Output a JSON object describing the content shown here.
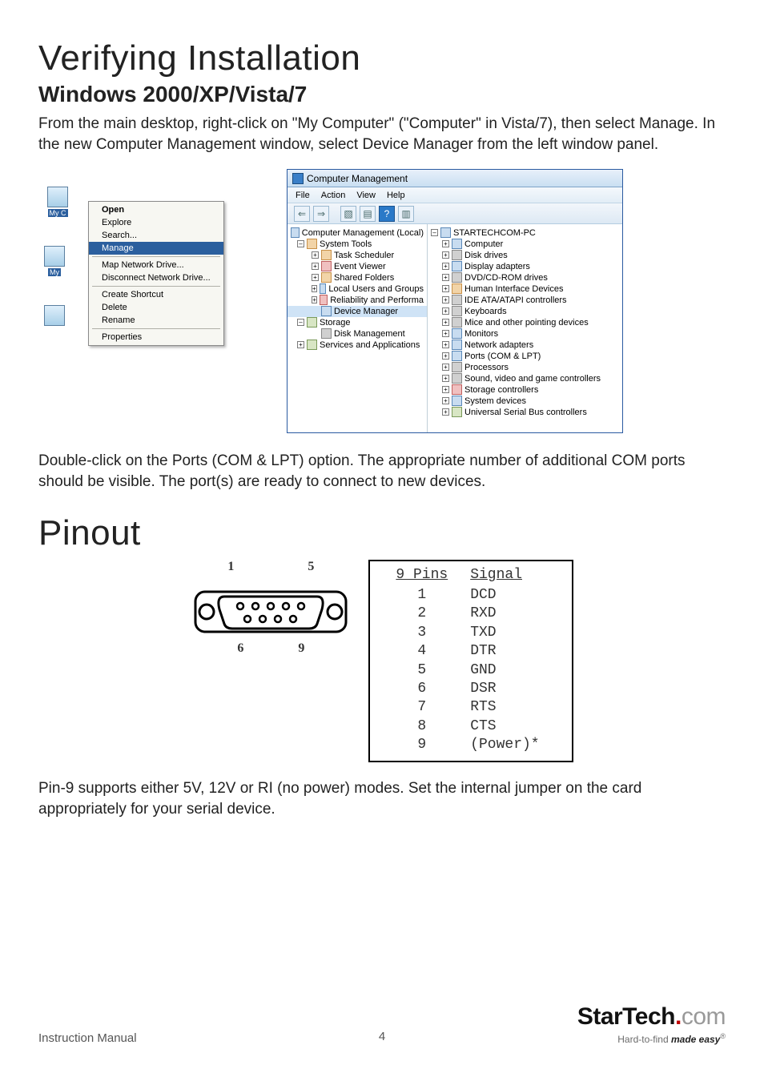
{
  "headings": {
    "h1_verify": "Verifying Installation",
    "h2_os": "Windows 2000/XP/Vista/7",
    "h1_pinout": "Pinout"
  },
  "paragraphs": {
    "intro": "From the main desktop, right-click on \"My Computer\" (\"Computer\" in Vista/7), then select Manage. In the new Computer Management window, select Device Manager from the left window panel.",
    "ports_note": "Double-click on the Ports (COM & LPT) option. The appropriate number of additional COM ports should be visible. The port(s) are ready to connect to new devices.",
    "pin9_note": "Pin-9 supports either 5V, 12V or RI (no power) modes.  Set the internal jumper on the card appropriately for your serial device."
  },
  "desktop_icons": {
    "icon1_label": "My C",
    "icon2_label": "My"
  },
  "context_menu": {
    "items_group1": [
      "Open",
      "Explore",
      "Search...",
      "Manage"
    ],
    "items_group2": [
      "Map Network Drive...",
      "Disconnect Network Drive..."
    ],
    "items_group3": [
      "Create Shortcut",
      "Delete",
      "Rename"
    ],
    "items_group4": [
      "Properties"
    ],
    "bold_index": 0,
    "selected_item": "Manage"
  },
  "cm_window": {
    "title": "Computer Management",
    "menus": [
      "File",
      "Action",
      "View",
      "Help"
    ],
    "toolbar_icons": [
      "back-icon",
      "forward-icon",
      "up-icon",
      "properties-icon",
      "help-icon",
      "refresh-icon"
    ],
    "left_tree": {
      "root": "Computer Management (Local)",
      "groups": [
        {
          "label": "System Tools",
          "children": [
            "Task Scheduler",
            "Event Viewer",
            "Shared Folders",
            "Local Users and Groups",
            "Reliability and Performa",
            "Device Manager"
          ],
          "selected": "Device Manager"
        },
        {
          "label": "Storage",
          "children": [
            "Disk Management"
          ]
        },
        {
          "label": "Services and Applications",
          "children": []
        }
      ]
    },
    "right_tree": {
      "root": "STARTECHCOM-PC",
      "children": [
        "Computer",
        "Disk drives",
        "Display adapters",
        "DVD/CD-ROM drives",
        "Human Interface Devices",
        "IDE ATA/ATAPI controllers",
        "Keyboards",
        "Mice and other pointing devices",
        "Monitors",
        "Network adapters",
        "Ports (COM & LPT)",
        "Processors",
        "Sound, video and game controllers",
        "Storage controllers",
        "System devices",
        "Universal Serial Bus controllers"
      ]
    }
  },
  "connector_labels": {
    "pin1": "1",
    "pin5": "5",
    "pin6": "6",
    "pin9": "9"
  },
  "pinout_table": {
    "header_pins": "9 Pins",
    "header_signal": "Signal",
    "rows": [
      {
        "pin": "1",
        "signal": "DCD"
      },
      {
        "pin": "2",
        "signal": "RXD"
      },
      {
        "pin": "3",
        "signal": "TXD"
      },
      {
        "pin": "4",
        "signal": "DTR"
      },
      {
        "pin": "5",
        "signal": "GND"
      },
      {
        "pin": "6",
        "signal": "DSR"
      },
      {
        "pin": "7",
        "signal": "RTS"
      },
      {
        "pin": "8",
        "signal": "CTS"
      },
      {
        "pin": "9",
        "signal": "(Power)*"
      }
    ]
  },
  "footer": {
    "manual": "Instruction Manual",
    "page_number": "4",
    "logo_bold": "StarTech",
    "logo_dot": ".",
    "logo_com": "com",
    "tagline_pre": "Hard-to-find ",
    "tagline_em": "made easy",
    "tagline_reg": "®"
  }
}
